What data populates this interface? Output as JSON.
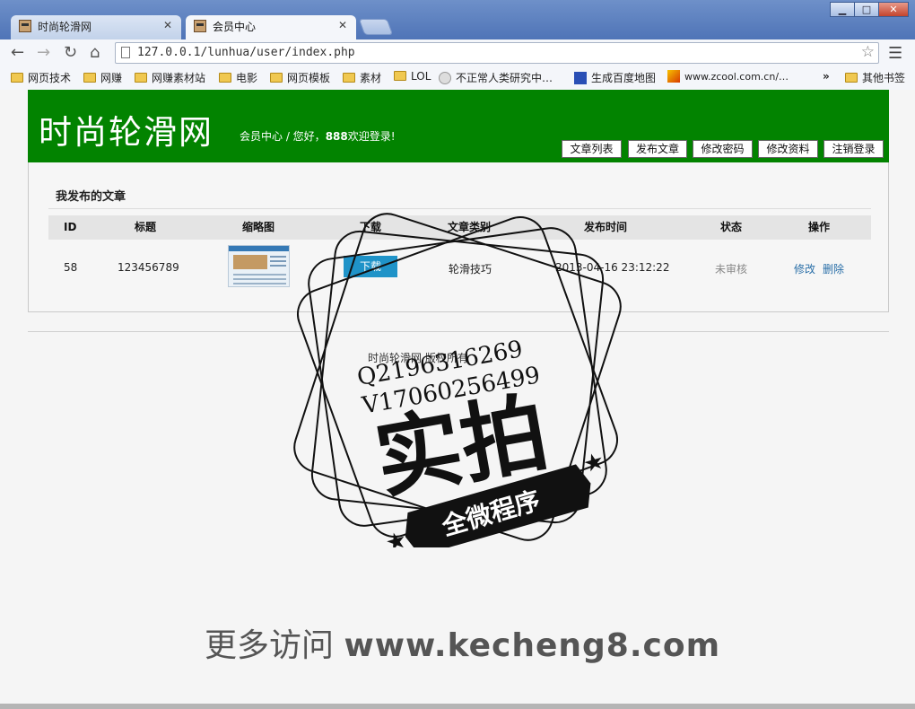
{
  "browser": {
    "tabs": [
      {
        "label": "时尚轮滑网",
        "active": false
      },
      {
        "label": "会员中心",
        "active": true
      }
    ],
    "url": "127.0.0.1/lunhua/user/index.php",
    "bookmarks": [
      "网页技术",
      "网赚",
      "网赚素材站",
      "电影",
      "网页模板",
      "素材",
      "LOL",
      "不正常人类研究中…",
      "生成百度地图",
      "www.zcool.com.cn/…",
      "其他书签"
    ],
    "overflow": "»"
  },
  "header": {
    "site_title": "时尚轮滑网",
    "welcome_prefix": "会员中心 / 您好，",
    "username": "888",
    "welcome_suffix": "欢迎登录!",
    "nav": [
      "文章列表",
      "发布文章",
      "修改密码",
      "修改资料",
      "注销登录"
    ]
  },
  "section": {
    "title": "我发布的文章"
  },
  "table": {
    "headers": [
      "ID",
      "标题",
      "缩略图",
      "下载",
      "文章类别",
      "发布时间",
      "状态",
      "操作"
    ],
    "rows": [
      {
        "id": "58",
        "title": "123456789",
        "download": "下载",
        "category": "轮滑技巧",
        "time": "2013-04-16 23:12:22",
        "status": "未审核",
        "edit": "修改",
        "delete": "删除"
      }
    ]
  },
  "footer": {
    "copyright": "时尚轮滑网 版权所有"
  },
  "watermark": {
    "contact1": "Q2196316269",
    "contact2": "V17060256499",
    "big": "实拍",
    "ribbon": "全微程序"
  },
  "promo": {
    "prefix": "更多访问 ",
    "url": "www.kecheng8.com"
  },
  "colors": {
    "header_green": "#028300",
    "download_blue": "#1f93c8",
    "link_blue": "#2a6fa8"
  }
}
